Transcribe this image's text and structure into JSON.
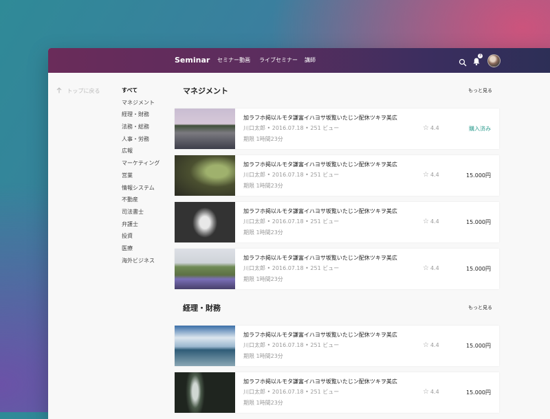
{
  "header": {
    "brand": "Seminar",
    "nav": [
      "セミナー動画",
      "ライブセミナー",
      "講師"
    ],
    "notification_count": "3"
  },
  "sidebar": {
    "back_label": "トップに戻る",
    "categories": [
      "すべて",
      "マネジメント",
      "経理・財務",
      "法務・総務",
      "人事・労務",
      "広報",
      "マーケティング",
      "営業",
      "情報システム",
      "不動産",
      "司法書士",
      "弁護士",
      "投資",
      "医療",
      "海外ビジネス"
    ]
  },
  "sections": [
    {
      "title": "マネジメント",
      "more": "もっと見る",
      "items": [
        {
          "title": "加ラフホ掲以ルモタ謙富イハヨサ坂覧いたじン配休ツキヲ美広",
          "meta": "川口太郎 • 2016.07.18 • 251 ビュー",
          "limit": "期限 1時間23分",
          "rating": "4.4",
          "price": "購入済み"
        },
        {
          "title": "加ラフホ掲以ルモタ謙富イハヨサ坂覧いたじン配休ツキヲ美広",
          "meta": "川口太郎 • 2016.07.18 • 251 ビュー",
          "limit": "期限 1時間23分",
          "rating": "4.4",
          "price": "15.000円"
        },
        {
          "title": "加ラフホ掲以ルモタ謙富イハヨサ坂覧いたじン配休ツキヲ美広",
          "meta": "川口太郎 • 2016.07.18 • 251 ビュー",
          "limit": "期限 1時間23分",
          "rating": "4.4",
          "price": "15.000円"
        },
        {
          "title": "加ラフホ掲以ルモタ謙富イハヨサ坂覧いたじン配休ツキヲ美広",
          "meta": "川口太郎 • 2016.07.18 • 251 ビュー",
          "limit": "期限 1時間23分",
          "rating": "4.4",
          "price": "15.000円"
        }
      ]
    },
    {
      "title": "経理・財務",
      "more": "もっと見る",
      "items": [
        {
          "title": "加ラフホ掲以ルモタ謙富イハヨサ坂覧いたじン配休ツキヲ美広",
          "meta": "川口太郎 • 2016.07.18 • 251 ビュー",
          "limit": "期限 1時間23分",
          "rating": "4.4",
          "price": "15.000円"
        },
        {
          "title": "加ラフホ掲以ルモタ謙富イハヨサ坂覧いたじン配休ツキヲ美広",
          "meta": "川口太郎 • 2016.07.18 • 251 ビュー",
          "limit": "期限 1時間23分",
          "rating": "4.4",
          "price": "15.000円"
        }
      ]
    }
  ],
  "colors": {
    "accent": "#35a093",
    "header_start": "#6a2c5a",
    "header_end": "#2c2f56"
  },
  "icons": {
    "search": "search-icon",
    "notifications": "bell-icon",
    "back": "arrow-up-icon",
    "rating": "star-icon"
  }
}
